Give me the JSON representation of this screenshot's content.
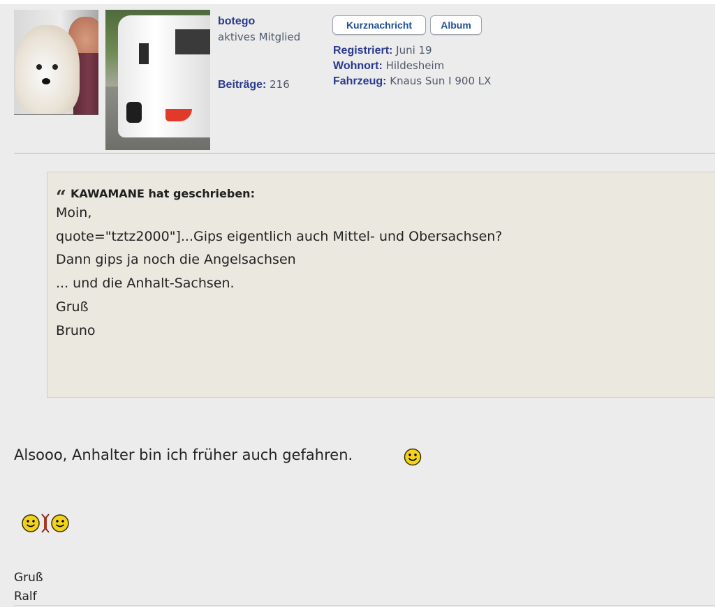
{
  "profile": {
    "username": "botego",
    "rank": "aktives Mitglied",
    "posts_label": "Beiträge:",
    "posts_value": "216",
    "buttons": {
      "message": "Kurznachricht",
      "album": "Album"
    },
    "registered_label": "Registriert:",
    "registered_value": "Juni 19",
    "location_label": "Wohnort:",
    "location_value": "Hildesheim",
    "vehicle_label": "Fahrzeug:",
    "vehicle_value": "Knaus Sun I 900 LX"
  },
  "quote": {
    "header": "KAWAMANE hat geschrieben:",
    "lines": [
      "Moin,",
      "quote=\"tztz2000\"]...Gips eigentlich auch Mittel- und Obersachsen?",
      "Dann gips ja noch die Angelsachsen",
      "",
      "... und die Anhalt-Sachsen.",
      "",
      "Gruß",
      "Bruno"
    ]
  },
  "post": {
    "text": "Alsooo, Anhalter bin ich früher auch gefahren.",
    "greeting": "Gruß",
    "signature": "Ralf"
  },
  "icons": {
    "quote_mark": "quote-mark-icon",
    "smiley": "smiley-icon",
    "smiley_pair": "double-smiley-icon"
  },
  "colors": {
    "username": "#2a3a8c",
    "button_text": "#1c4f93",
    "quote_bg": "#eae8df",
    "page_bg": "#ececec"
  }
}
